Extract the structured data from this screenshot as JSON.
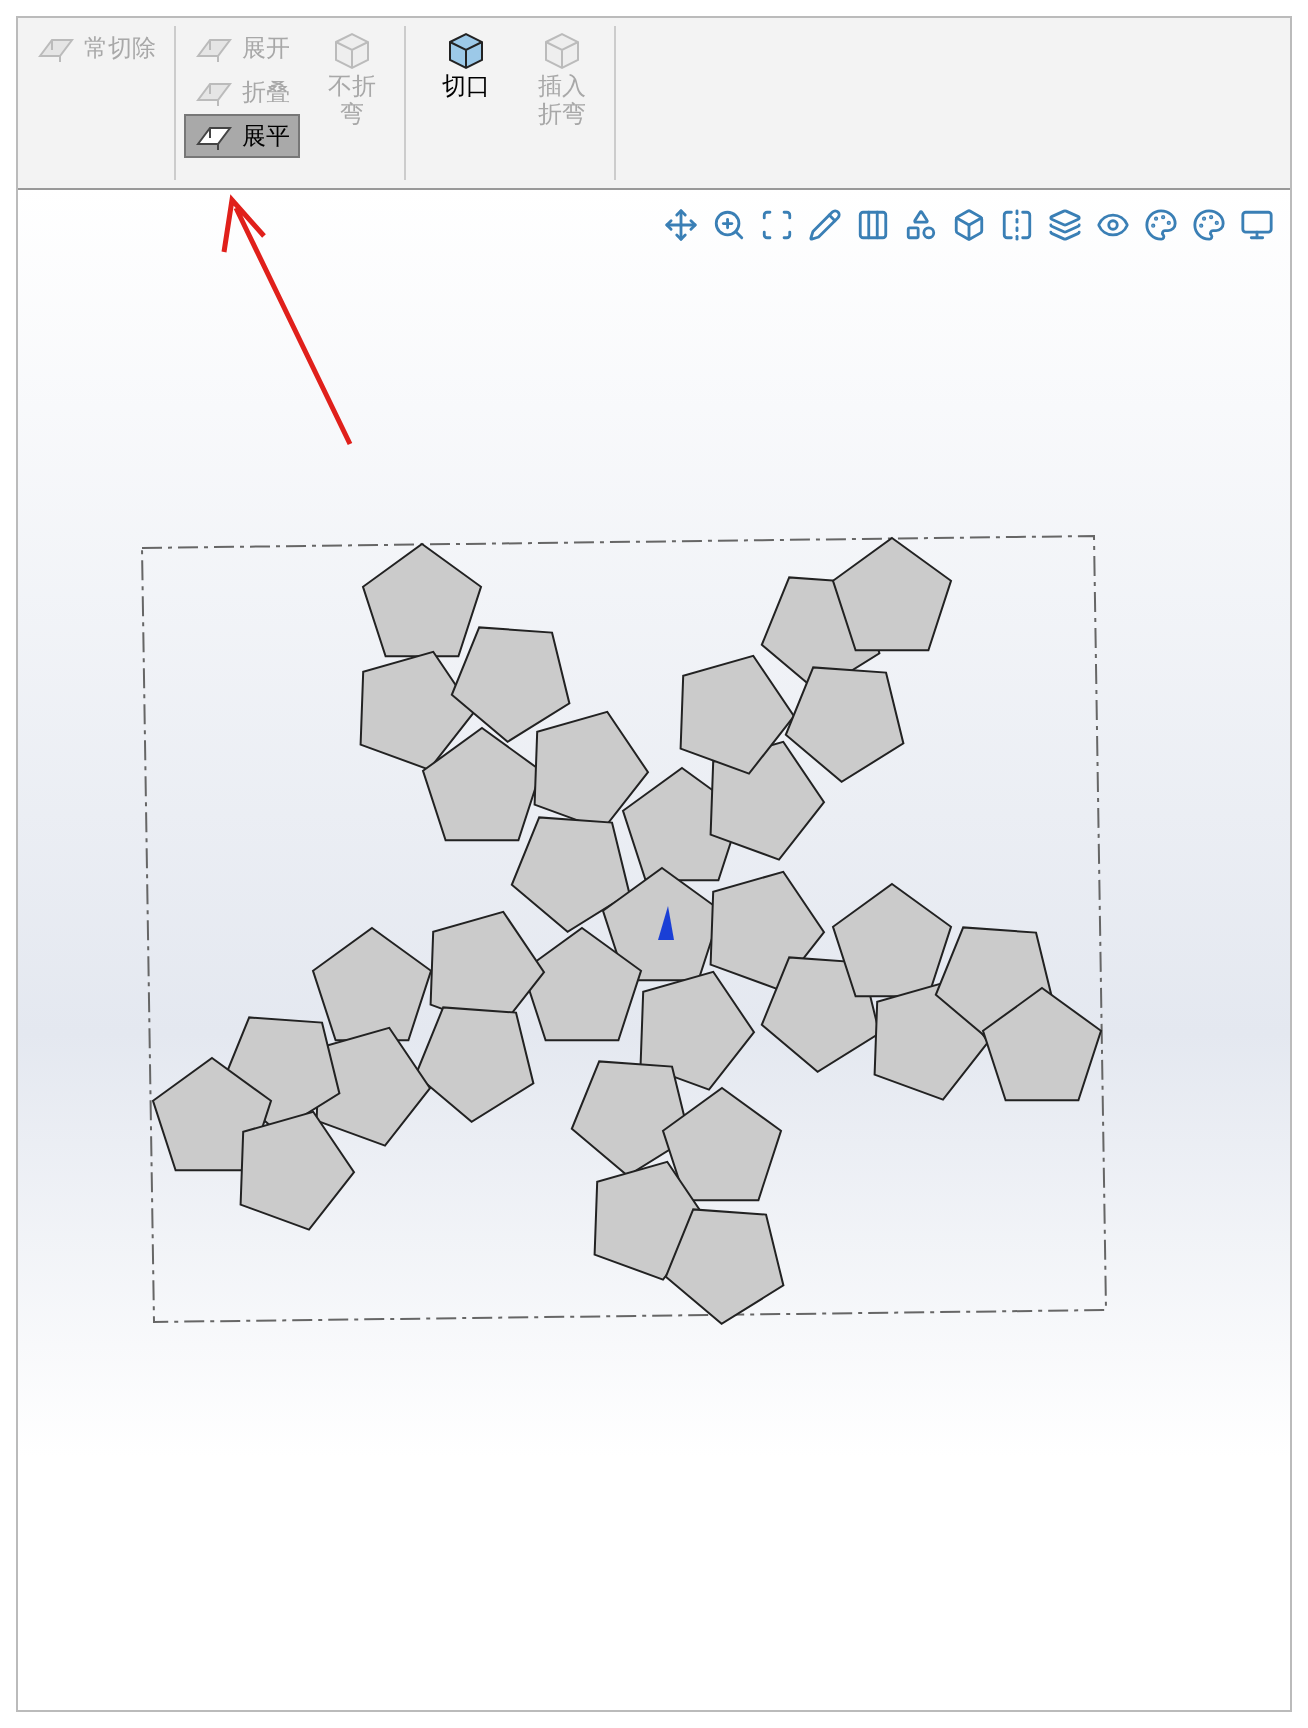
{
  "ribbon": {
    "groups": [
      {
        "items": [
          {
            "label": "常切除",
            "kind": "small",
            "disabled": true,
            "selected": false
          }
        ]
      },
      {
        "items": [
          {
            "label": "展开",
            "kind": "small",
            "disabled": true,
            "selected": false
          },
          {
            "label": "折叠",
            "kind": "small",
            "disabled": true,
            "selected": false
          },
          {
            "label": "展平",
            "kind": "small",
            "disabled": false,
            "selected": true
          },
          {
            "label": "不折弯",
            "kind": "large",
            "disabled": true,
            "selected": false
          }
        ]
      },
      {
        "items": [
          {
            "label": "切口",
            "kind": "large",
            "disabled": false,
            "selected": false
          },
          {
            "label": "插入折弯",
            "kind": "large",
            "disabled": true,
            "selected": false
          }
        ]
      }
    ]
  }
}
